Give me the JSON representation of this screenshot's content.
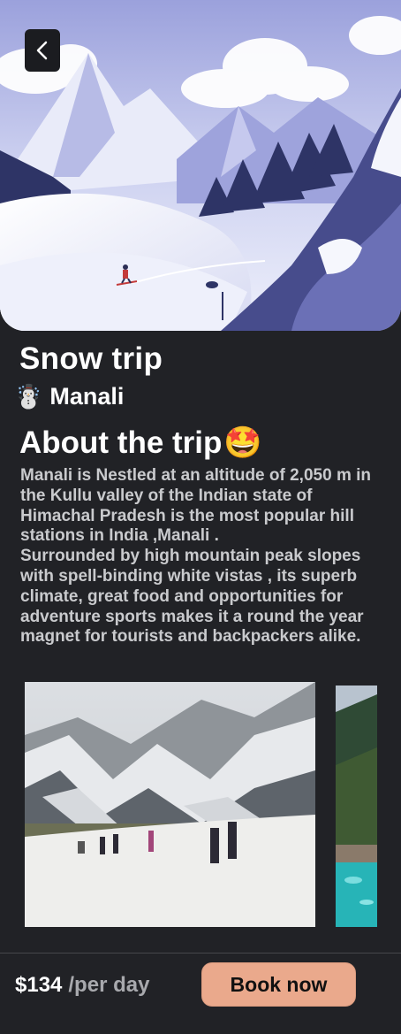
{
  "trip": {
    "title": "Snow trip",
    "location_emoji": "☃️",
    "location": "Manali"
  },
  "about": {
    "heading": "About the trip",
    "heading_emoji": "🤩",
    "text": "Manali is Nestled at an altitude of 2,050 m in the Kullu valley of the Indian state of Himachal Pradesh is the most popular hill stations in India ,Manali .\nSurrounded by high mountain peak slopes with spell-binding white vistas , its superb climate, great food and opportunities for adventure sports makes it a round the year magnet for tourists and backpackers alike."
  },
  "footer": {
    "price": "$134",
    "price_unit": "/per day",
    "book_label": "Book now"
  },
  "colors": {
    "background": "#212226",
    "accent": "#eaa98c"
  },
  "icons": {
    "back": "chevron-left-icon"
  }
}
